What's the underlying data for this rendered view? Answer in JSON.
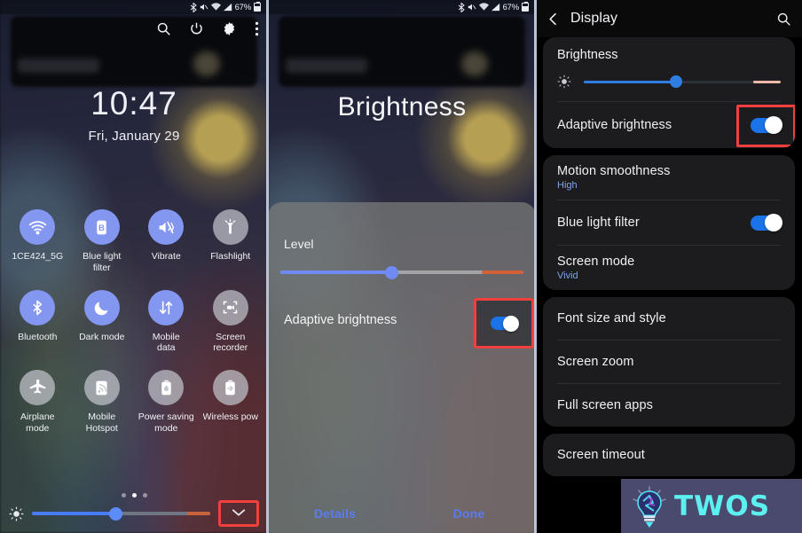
{
  "status_bar": {
    "battery_percent": "67%",
    "icons": [
      "bluetooth-icon",
      "mute-icon",
      "wifi-icon",
      "signal-icon"
    ]
  },
  "panel1": {
    "name": "quick-settings-panel",
    "toolbar": [
      {
        "icon": "search-icon",
        "label": "Search"
      },
      {
        "icon": "power-icon",
        "label": "Power"
      },
      {
        "icon": "gear-icon",
        "label": "Settings"
      },
      {
        "icon": "more-vertical-icon",
        "label": "More options"
      }
    ],
    "clock": {
      "time": "10:47",
      "date": "Fri, January 29"
    },
    "tiles": [
      {
        "label": "1CE424_5G",
        "icon": "wifi-icon",
        "state": "on"
      },
      {
        "label": "Blue light\nfilter",
        "icon": "blue-light-filter-icon",
        "state": "on"
      },
      {
        "label": "Vibrate",
        "icon": "vibrate-icon",
        "state": "on"
      },
      {
        "label": "Flashlight",
        "icon": "flashlight-icon",
        "state": "off"
      },
      {
        "label": "Bluetooth",
        "icon": "bluetooth-icon",
        "state": "on"
      },
      {
        "label": "Dark mode",
        "icon": "moon-icon",
        "state": "on"
      },
      {
        "label": "Mobile\ndata",
        "icon": "mobile-data-icon",
        "state": "on"
      },
      {
        "label": "Screen\nrecorder",
        "icon": "screen-recorder-icon",
        "state": "off"
      },
      {
        "label": "Airplane\nmode",
        "icon": "airplane-icon",
        "state": "off"
      },
      {
        "label": "Mobile\nHotspot",
        "icon": "hotspot-icon",
        "state": "off"
      },
      {
        "label": "Power saving\nmode",
        "icon": "power-saving-icon",
        "state": "off"
      },
      {
        "label": "Wireless pow",
        "icon": "wireless-power-share-icon",
        "state": "off"
      }
    ],
    "pages": {
      "count": 3,
      "active": 1
    },
    "brightness": {
      "icon": "sun-icon",
      "value_percent": 47,
      "warm_percent": 87
    },
    "collapse": {
      "icon": "chevron-down-icon",
      "highlighted": true
    }
  },
  "panel2": {
    "name": "brightness-dialog-panel",
    "title": "Brightness",
    "level_label": "Level",
    "level": {
      "value_percent": 46,
      "warm_percent": 83
    },
    "adaptive_label": "Adaptive brightness",
    "adaptive_state": "on",
    "adaptive_highlighted": true,
    "buttons": {
      "details": "Details",
      "done": "Done"
    }
  },
  "panel3": {
    "name": "display-settings-panel",
    "header": {
      "back_icon": "back-chevron-icon",
      "title": "Display",
      "search_icon": "search-icon"
    },
    "brightness": {
      "title": "Brightness",
      "icon": "sun-icon",
      "value_percent": 47,
      "warm_percent": 86
    },
    "rows": [
      {
        "label": "Adaptive brightness",
        "sub": "",
        "control": "toggle",
        "state": "on",
        "highlighted": true
      },
      {
        "label": "Motion smoothness",
        "sub": "High",
        "control": "none"
      },
      {
        "label": "Blue light filter",
        "sub": "",
        "control": "toggle",
        "state": "on"
      },
      {
        "label": "Screen mode",
        "sub": "Vivid",
        "control": "none"
      },
      {
        "label": "Font size and style",
        "sub": "",
        "control": "none"
      },
      {
        "label": "Screen zoom",
        "sub": "",
        "control": "none"
      },
      {
        "label": "Full screen apps",
        "sub": "",
        "control": "none"
      },
      {
        "label": "Screen timeout",
        "sub": "",
        "control": "none"
      }
    ]
  },
  "watermark": {
    "text": "TWOS",
    "icon": "lightbulb-icon",
    "bg_color": "#4a4a6e",
    "text_color": "#5cf0f0"
  },
  "colors": {
    "highlight_red": "#f43f3f",
    "toggle_blue": "#1a73e8",
    "tile_on": "#8396f0",
    "tile_off": "#c4c7ce",
    "link_blue": "#5b7bf0",
    "sub_blue": "#7aa7f0"
  }
}
